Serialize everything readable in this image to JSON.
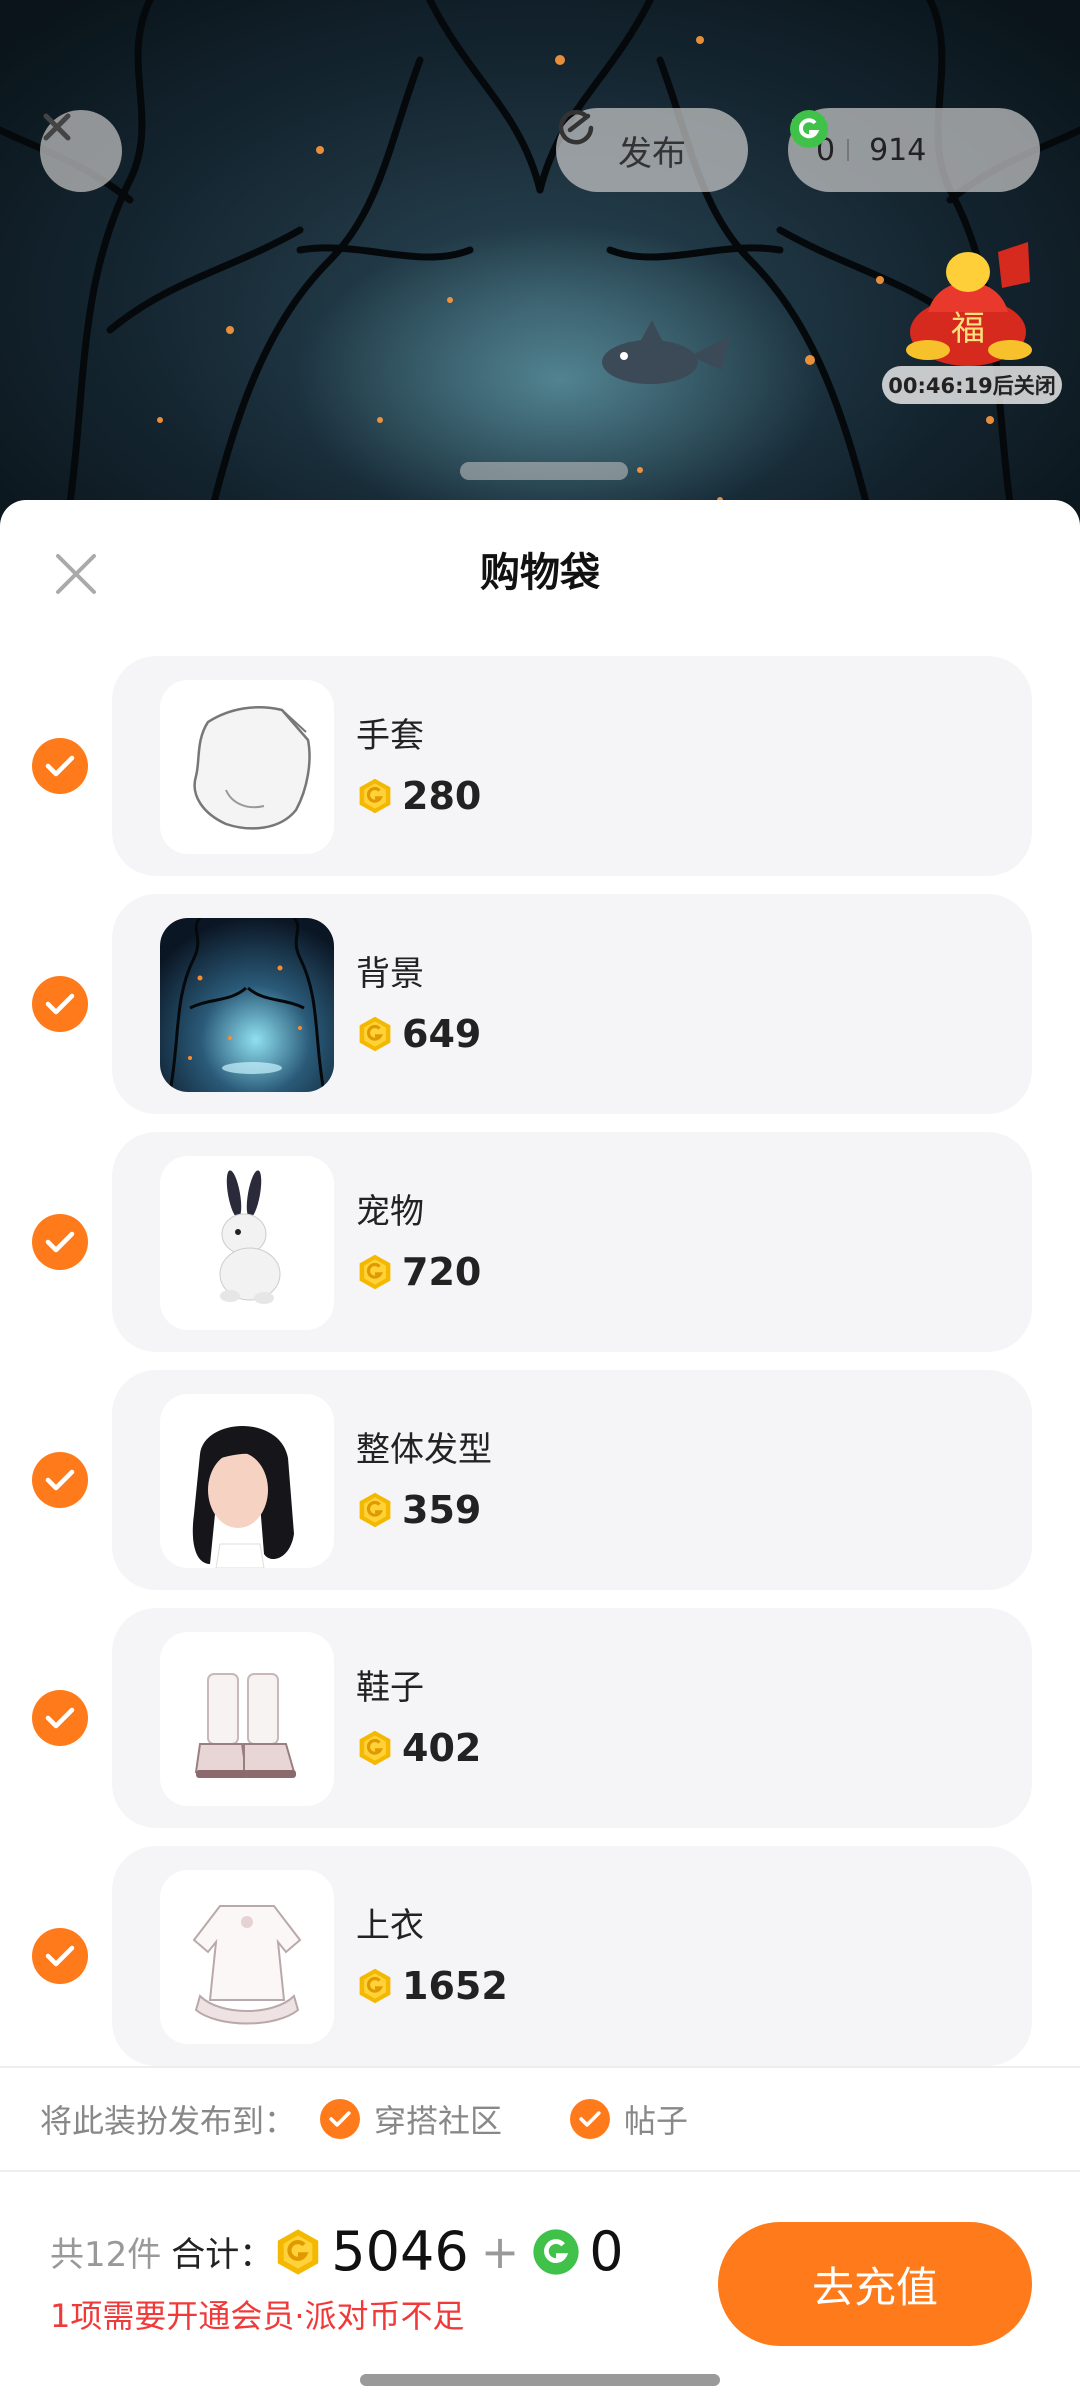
{
  "topbar": {
    "publish_label": "发布",
    "coin_gold": "0",
    "coin_green": "914",
    "countdown": "00:46:19后关闭",
    "fu_char": "福"
  },
  "sheet": {
    "title": "购物袋",
    "items": [
      {
        "name": "手套",
        "price": "280"
      },
      {
        "name": "背景",
        "price": "649"
      },
      {
        "name": "宠物",
        "price": "720"
      },
      {
        "name": "整体发型",
        "price": "359"
      },
      {
        "name": "鞋子",
        "price": "402"
      },
      {
        "name": "上衣",
        "price": "1652"
      }
    ]
  },
  "publish_to": {
    "label": "将此装扮发布到：",
    "options": [
      "穿搭社区",
      "帖子"
    ]
  },
  "summary": {
    "count": "共12件",
    "total_label": "合计：",
    "gold_total": "5046",
    "plus": "+",
    "green_total": "0",
    "warning": "1项需要开通会员·派对币不足"
  },
  "recharge_label": "去充值",
  "colors": {
    "accent": "#ff7a1a",
    "warning": "#f03a3a",
    "gold_coin": "#f5b800",
    "green_coin": "#3fc14a"
  },
  "icons": [
    "close-icon",
    "publish-icon",
    "gold-coin-icon",
    "green-coin-icon",
    "check-icon"
  ]
}
